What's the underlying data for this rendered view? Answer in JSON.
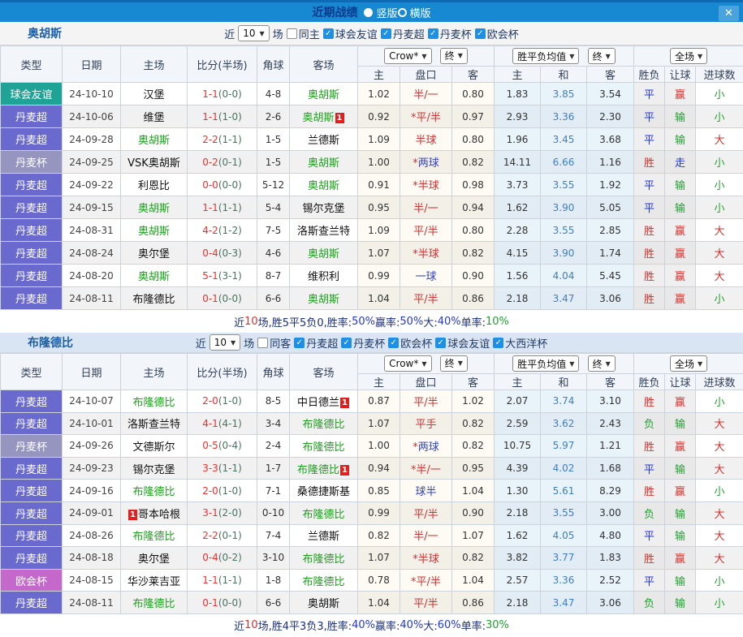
{
  "titlebar": {
    "title": "近期战绩",
    "radio_options": [
      {
        "label": "竖版",
        "selected": true
      },
      {
        "label": "横版",
        "selected": false
      }
    ],
    "close_label": "✕"
  },
  "filter_labels": {
    "near": "近",
    "matches": "场"
  },
  "columns": {
    "left": [
      "类型",
      "日期",
      "主场",
      "比分(半场)",
      "角球",
      "客场"
    ],
    "sub": [
      "主",
      "盘口",
      "客",
      "主",
      "和",
      "客",
      "胜负",
      "让球",
      "进球数"
    ],
    "dropdowns": [
      "Crow*",
      "终",
      "胜平负均值",
      "终",
      "全场"
    ]
  },
  "type_colors": {
    "球会友谊": "#1fa396",
    "丹麦超": "#6a6ace",
    "丹麦杯": "#9595bf",
    "欧会杯": "#c468cc"
  },
  "result_colors": {
    "胜": "red",
    "负": "green",
    "平": "blue",
    "赢": "red",
    "输": "green",
    "走": "blue",
    "大": "red",
    "小": "green"
  },
  "sections": [
    {
      "team": "奥胡斯",
      "filter": {
        "count": "10",
        "same": "同主",
        "same_checked": false,
        "leagues": [
          "球会友谊",
          "丹麦超",
          "丹麦杯",
          "欧会杯"
        ]
      },
      "rows": [
        {
          "type": "球会友谊",
          "date": "24-10-10",
          "home": {
            "n": "汉堡"
          },
          "score": "1-1",
          "half": "(0-0)",
          "corner": "4-8",
          "away": {
            "n": "奥胡斯",
            "g": 1
          },
          "o1": "1.02",
          "hc": "半/一",
          "hcc": "red",
          "o2": "0.80",
          "w": "1.83",
          "d": "3.85",
          "l": "3.54",
          "res": "平",
          "rq": "赢",
          "jq": "小"
        },
        {
          "type": "丹麦超",
          "date": "24-10-06",
          "home": {
            "n": "维堡"
          },
          "score": "1-1",
          "half": "(1-0)",
          "corner": "2-6",
          "away": {
            "n": "奥胡斯",
            "g": 1,
            "b": "1",
            "bp": "after"
          },
          "o1": "0.92",
          "hc": "*平/半",
          "hcc": "red",
          "o2": "0.97",
          "w": "2.93",
          "d": "3.36",
          "l": "2.30",
          "res": "平",
          "rq": "输",
          "jq": "小"
        },
        {
          "type": "丹麦超",
          "date": "24-09-28",
          "home": {
            "n": "奥胡斯",
            "g": 1
          },
          "score": "2-2",
          "half": "(1-1)",
          "corner": "1-5",
          "away": {
            "n": "兰德斯"
          },
          "o1": "1.09",
          "hc": "半球",
          "hcc": "red",
          "o2": "0.80",
          "w": "1.96",
          "d": "3.45",
          "l": "3.68",
          "res": "平",
          "rq": "输",
          "jq": "大"
        },
        {
          "type": "丹麦杯",
          "date": "24-09-25",
          "home": {
            "n": "VSK奥胡斯"
          },
          "score": "0-2",
          "half": "(0-1)",
          "corner": "1-5",
          "away": {
            "n": "奥胡斯",
            "g": 1
          },
          "o1": "1.00",
          "hc": "*两球",
          "hcc": "blue",
          "o2": "0.82",
          "w": "14.11",
          "d": "6.66",
          "l": "1.16",
          "res": "胜",
          "rq": "走",
          "jq": "小"
        },
        {
          "type": "丹麦超",
          "date": "24-09-22",
          "home": {
            "n": "利恩比"
          },
          "score": "0-0",
          "half": "(0-0)",
          "corner": "5-12",
          "away": {
            "n": "奥胡斯",
            "g": 1
          },
          "o1": "0.91",
          "hc": "*半球",
          "hcc": "red",
          "o2": "0.98",
          "w": "3.73",
          "d": "3.55",
          "l": "1.92",
          "res": "平",
          "rq": "输",
          "jq": "小"
        },
        {
          "type": "丹麦超",
          "date": "24-09-15",
          "home": {
            "n": "奥胡斯",
            "g": 1
          },
          "score": "1-1",
          "half": "(1-1)",
          "corner": "5-4",
          "away": {
            "n": "锡尔克堡"
          },
          "o1": "0.95",
          "hc": "半/一",
          "hcc": "red",
          "o2": "0.94",
          "w": "1.62",
          "d": "3.90",
          "l": "5.05",
          "res": "平",
          "rq": "输",
          "jq": "小"
        },
        {
          "type": "丹麦超",
          "date": "24-08-31",
          "home": {
            "n": "奥胡斯",
            "g": 1
          },
          "score": "4-2",
          "half": "(1-2)",
          "corner": "7-5",
          "away": {
            "n": "洛斯查兰特"
          },
          "o1": "1.09",
          "hc": "平/半",
          "hcc": "red",
          "o2": "0.80",
          "w": "2.28",
          "d": "3.55",
          "l": "2.85",
          "res": "胜",
          "rq": "赢",
          "jq": "大"
        },
        {
          "type": "丹麦超",
          "date": "24-08-24",
          "home": {
            "n": "奥尔堡"
          },
          "score": "0-4",
          "half": "(0-3)",
          "corner": "4-6",
          "away": {
            "n": "奥胡斯",
            "g": 1
          },
          "o1": "1.07",
          "hc": "*半球",
          "hcc": "red",
          "o2": "0.82",
          "w": "4.15",
          "d": "3.90",
          "l": "1.74",
          "res": "胜",
          "rq": "赢",
          "jq": "大"
        },
        {
          "type": "丹麦超",
          "date": "24-08-20",
          "home": {
            "n": "奥胡斯",
            "g": 1
          },
          "score": "5-1",
          "half": "(3-1)",
          "corner": "8-7",
          "away": {
            "n": "维积利"
          },
          "o1": "0.99",
          "hc": "一球",
          "hcc": "blue",
          "o2": "0.90",
          "w": "1.56",
          "d": "4.04",
          "l": "5.45",
          "res": "胜",
          "rq": "赢",
          "jq": "大"
        },
        {
          "type": "丹麦超",
          "date": "24-08-11",
          "home": {
            "n": "布隆德比"
          },
          "score": "0-1",
          "half": "(0-0)",
          "corner": "6-6",
          "away": {
            "n": "奥胡斯",
            "g": 1
          },
          "o1": "1.04",
          "hc": "平/半",
          "hcc": "red",
          "o2": "0.86",
          "w": "2.18",
          "d": "3.47",
          "l": "3.06",
          "res": "胜",
          "rq": "赢",
          "jq": "小"
        }
      ],
      "summary": [
        [
          "近",
          "navy"
        ],
        [
          "10",
          "red"
        ],
        [
          "场,胜5平5负0, ",
          "navy"
        ],
        [
          "胜率:",
          "navy"
        ],
        [
          "50%",
          "blue"
        ],
        [
          " 赢率:",
          "navy"
        ],
        [
          "50%",
          "blue"
        ],
        [
          " 大:",
          "navy"
        ],
        [
          "40%",
          "blue"
        ],
        [
          " 单率:",
          "navy"
        ],
        [
          "10%",
          "green"
        ]
      ]
    },
    {
      "team": "布隆德比",
      "filter": {
        "count": "10",
        "same": "同客",
        "same_checked": false,
        "leagues": [
          "丹麦超",
          "丹麦杯",
          "欧会杯",
          "球会友谊",
          "大西洋杯"
        ]
      },
      "rows": [
        {
          "type": "丹麦超",
          "date": "24-10-07",
          "home": {
            "n": "布隆德比",
            "g": 1
          },
          "score": "2-0",
          "half": "(1-0)",
          "corner": "8-5",
          "away": {
            "n": "中日德兰",
            "b": "1",
            "bp": "after"
          },
          "o1": "0.87",
          "hc": "平/半",
          "hcc": "red",
          "o2": "1.02",
          "w": "2.07",
          "d": "3.74",
          "l": "3.10",
          "res": "胜",
          "rq": "赢",
          "jq": "小"
        },
        {
          "type": "丹麦超",
          "date": "24-10-01",
          "home": {
            "n": "洛斯查兰特"
          },
          "score": "4-1",
          "half": "(4-1)",
          "corner": "3-4",
          "away": {
            "n": "布隆德比",
            "g": 1
          },
          "o1": "1.07",
          "hc": "平手",
          "hcc": "red",
          "o2": "0.82",
          "w": "2.59",
          "d": "3.62",
          "l": "2.43",
          "res": "负",
          "rq": "输",
          "jq": "大"
        },
        {
          "type": "丹麦杯",
          "date": "24-09-26",
          "home": {
            "n": "文德斯尔"
          },
          "score": "0-5",
          "half": "(0-4)",
          "corner": "2-4",
          "away": {
            "n": "布隆德比",
            "g": 1
          },
          "o1": "1.00",
          "hc": "*两球",
          "hcc": "blue",
          "o2": "0.82",
          "w": "10.75",
          "d": "5.97",
          "l": "1.21",
          "res": "胜",
          "rq": "赢",
          "jq": "大"
        },
        {
          "type": "丹麦超",
          "date": "24-09-23",
          "home": {
            "n": "锡尔克堡"
          },
          "score": "3-3",
          "half": "(1-1)",
          "corner": "1-7",
          "away": {
            "n": "布隆德比",
            "g": 1,
            "b": "1",
            "bp": "after"
          },
          "o1": "0.94",
          "hc": "*半/一",
          "hcc": "red",
          "o2": "0.95",
          "w": "4.39",
          "d": "4.02",
          "l": "1.68",
          "res": "平",
          "rq": "输",
          "jq": "大"
        },
        {
          "type": "丹麦超",
          "date": "24-09-16",
          "home": {
            "n": "布隆德比",
            "g": 1
          },
          "score": "2-0",
          "half": "(1-0)",
          "corner": "7-1",
          "away": {
            "n": "桑德捷斯基"
          },
          "o1": "0.85",
          "hc": "球半",
          "hcc": "blue",
          "o2": "1.04",
          "w": "1.30",
          "d": "5.61",
          "l": "8.29",
          "res": "胜",
          "rq": "赢",
          "jq": "小"
        },
        {
          "type": "丹麦超",
          "date": "24-09-01",
          "home": {
            "n": "哥本哈根",
            "b": "1",
            "bp": "before"
          },
          "score": "3-1",
          "half": "(2-0)",
          "corner": "0-10",
          "away": {
            "n": "布隆德比",
            "g": 1
          },
          "o1": "0.99",
          "hc": "平/半",
          "hcc": "red",
          "o2": "0.90",
          "w": "2.18",
          "d": "3.55",
          "l": "3.00",
          "res": "负",
          "rq": "输",
          "jq": "大"
        },
        {
          "type": "丹麦超",
          "date": "24-08-26",
          "home": {
            "n": "布隆德比",
            "g": 1
          },
          "score": "2-2",
          "half": "(0-1)",
          "corner": "7-4",
          "away": {
            "n": "兰德斯"
          },
          "o1": "0.82",
          "hc": "半/一",
          "hcc": "red",
          "o2": "1.07",
          "w": "1.62",
          "d": "4.05",
          "l": "4.80",
          "res": "平",
          "rq": "输",
          "jq": "大"
        },
        {
          "type": "丹麦超",
          "date": "24-08-18",
          "home": {
            "n": "奥尔堡"
          },
          "score": "0-4",
          "half": "(0-2)",
          "corner": "3-10",
          "away": {
            "n": "布隆德比",
            "g": 1
          },
          "o1": "1.07",
          "hc": "*半球",
          "hcc": "red",
          "o2": "0.82",
          "w": "3.82",
          "d": "3.77",
          "l": "1.83",
          "res": "胜",
          "rq": "赢",
          "jq": "大"
        },
        {
          "type": "欧会杯",
          "date": "24-08-15",
          "home": {
            "n": "华沙莱吉亚"
          },
          "score": "1-1",
          "half": "(1-1)",
          "corner": "1-8",
          "away": {
            "n": "布隆德比",
            "g": 1
          },
          "o1": "0.78",
          "hc": "*平/半",
          "hcc": "red",
          "o2": "1.04",
          "w": "2.57",
          "d": "3.36",
          "l": "2.52",
          "res": "平",
          "rq": "输",
          "jq": "小"
        },
        {
          "type": "丹麦超",
          "date": "24-08-11",
          "home": {
            "n": "布隆德比",
            "g": 1
          },
          "score": "0-1",
          "half": "(0-0)",
          "corner": "6-6",
          "away": {
            "n": "奥胡斯"
          },
          "o1": "1.04",
          "hc": "平/半",
          "hcc": "red",
          "o2": "0.86",
          "w": "2.18",
          "d": "3.47",
          "l": "3.06",
          "res": "负",
          "rq": "输",
          "jq": "小"
        }
      ],
      "summary": [
        [
          "近",
          "navy"
        ],
        [
          "10",
          "red"
        ],
        [
          "场,胜4平3负3, ",
          "navy"
        ],
        [
          "胜率:",
          "navy"
        ],
        [
          "40%",
          "blue"
        ],
        [
          " 赢率:",
          "navy"
        ],
        [
          "40%",
          "blue"
        ],
        [
          " 大:",
          "navy"
        ],
        [
          "60%",
          "blue"
        ],
        [
          " 单率:",
          "navy"
        ],
        [
          "30%",
          "green"
        ]
      ]
    }
  ]
}
